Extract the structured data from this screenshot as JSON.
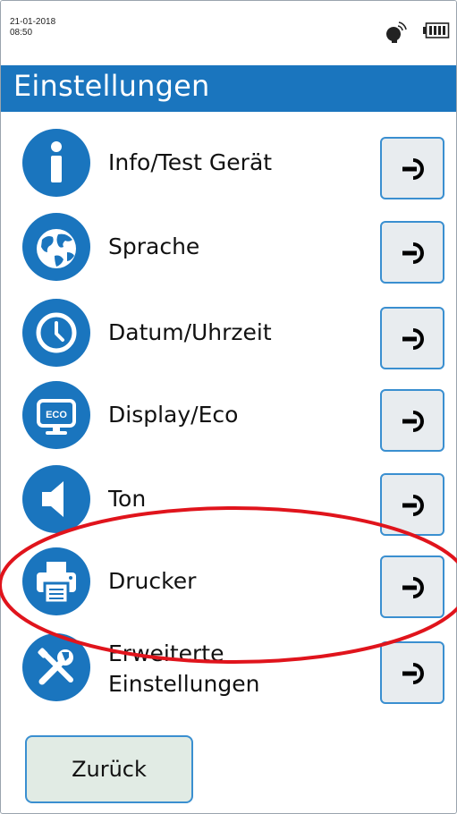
{
  "status": {
    "date": "21-01-2018",
    "time": "08:50",
    "icons": [
      "satellite-icon",
      "battery-icon"
    ]
  },
  "header": {
    "title": "Einstellungen"
  },
  "menu": {
    "items": [
      {
        "label": "Info/Test Gerät",
        "icon": "info-icon"
      },
      {
        "label": "Sprache",
        "icon": "globe-icon"
      },
      {
        "label": "Datum/Uhrzeit",
        "icon": "clock-icon"
      },
      {
        "label": "Display/Eco",
        "icon": "display-eco-icon",
        "icon_text": "ECO"
      },
      {
        "label": "Ton",
        "icon": "speaker-icon"
      },
      {
        "label": "Drucker",
        "icon": "printer-icon",
        "highlighted": true
      },
      {
        "label_line1": "Erweiterte",
        "label_line2": "Einstellungen",
        "icon": "tools-icon"
      }
    ],
    "arrow_icon": "arrow-right-icon"
  },
  "footer": {
    "back_label": "Zurück"
  },
  "colors": {
    "accent": "#1a75be",
    "button_border": "#3a8fd0",
    "button_bg": "#e8ecef",
    "back_bg": "#e1ebe4",
    "annotation": "#e0141c"
  }
}
